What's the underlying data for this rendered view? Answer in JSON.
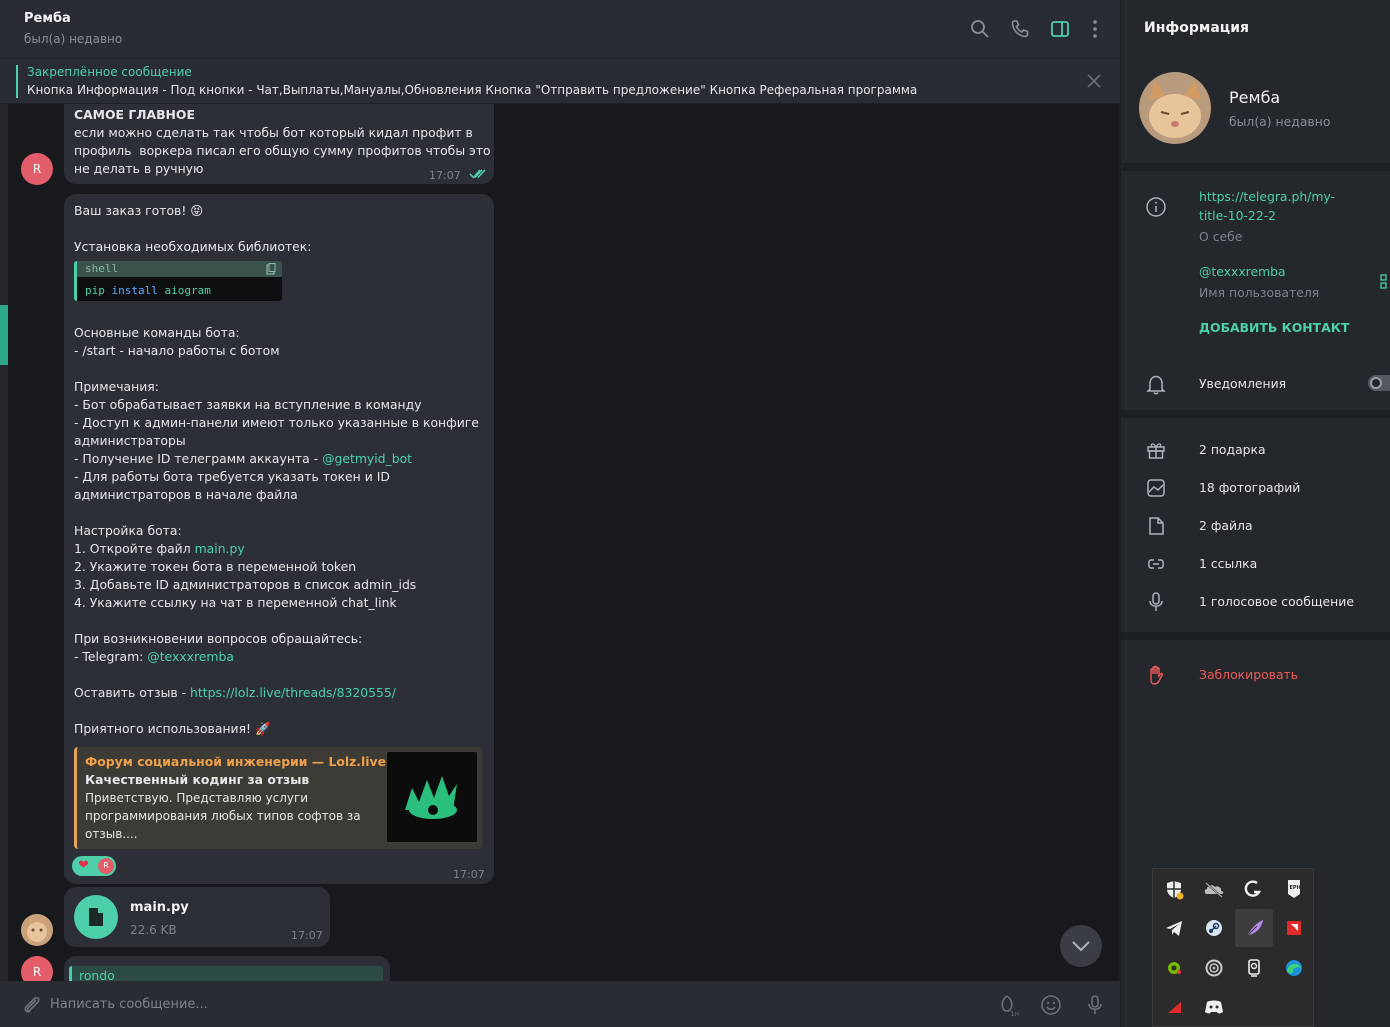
{
  "header": {
    "name": "Ремба",
    "status": "был(а) недавно"
  },
  "pinned": {
    "title": "Закреплённое сообщение",
    "text": "Кнопка Информация - Под кнопки - Чат,Выплаты,Мануалы,Обновления Кнопка \"Отправить предложение\"  Кнопка Реферальная программа"
  },
  "messages": {
    "m1": {
      "lines": [
        "САМОЕ ГЛАВНОЕ",
        "если можно сделать так чтобы бот который кидал профит в",
        "профиль  воркера писал его общую сумму профитов чтобы это",
        "не делать в ручную"
      ],
      "time": "17:07",
      "avatar": "R"
    },
    "m2": {
      "greeting": "Ваш заказ готов! 😝",
      "install_title": "Установка необходимых библиотек:",
      "code_lang": "shell",
      "code_cmd": "pip",
      "code_sub": "install",
      "code_pkg": "aiogram",
      "commands_title": "Основные команды бота:",
      "commands": [
        "- /start - начало работы с ботом"
      ],
      "notes_title": "Примечания:",
      "notes1": "- Бот обрабатывает заявки на вступление в команду",
      "notes2": "- Доступ к админ-панели имеют только указанные в конфиге",
      "notes3": "администраторы",
      "notes4_pre": "- Получение ID телеграмм аккаунта - ",
      "notes4_link": "@getmyid_bot",
      "notes5": "- Для работы бота требуется указать токен и ID",
      "notes6": "администраторов в начале файла",
      "setup_title": "Настройка бота:",
      "setup1_pre": "1. Откройте файл ",
      "setup1_link": "main.py",
      "setup2": "2. Укажите токен бота в переменной token",
      "setup3": "3. Добавьте ID администраторов в список admin_ids",
      "setup4": "4. Укажите ссылку на чат в переменной chat_link",
      "contact_title": "При возникновении вопросов обращайтесь:",
      "contact_pre": "- Telegram: ",
      "contact_link": "@texxxremba",
      "review_pre": "Оставить отзыв - ",
      "review_link": "https://lolz.live/threads/8320555/",
      "bye": "Приятного использования! 🚀",
      "preview": {
        "title": "Форум социальной инженерии —  Lolz.live...",
        "subtitle": "Качественный кодинг за отзыв",
        "text": "Приветствую. Представляю услуги программирования любых типов софтов за отзыв...."
      },
      "reaction": "❤",
      "time": "17:07"
    },
    "m3": {
      "file_name": "main.py",
      "file_size": "22.6 KB",
      "time": "17:07"
    },
    "m4": {
      "reply_name": "rondo",
      "avatar": "R"
    }
  },
  "input": {
    "placeholder": "Написать сообщение..."
  },
  "panel": {
    "title": "Информация",
    "name": "Ремба",
    "status": "был(а) недавно",
    "bio_link1": "https://telegra.ph/my-",
    "bio_link2": "title-10-22-2",
    "bio_label": "О себе",
    "username": "@texxxremba",
    "username_label": "Имя пользователя",
    "add_contact": "ДОБАВИТЬ КОНТАКТ",
    "notifications": "Уведомления",
    "media": [
      "2 подарка",
      "18 фотографий",
      "2 файла",
      "1 ссылка",
      "1 голосовое сообщение"
    ],
    "block": "Заблокировать"
  },
  "colors": {
    "accent": "#4dd0a9",
    "danger": "#ee5a5a",
    "bubble": "#2c3036",
    "chat_bg": "#17191d"
  }
}
